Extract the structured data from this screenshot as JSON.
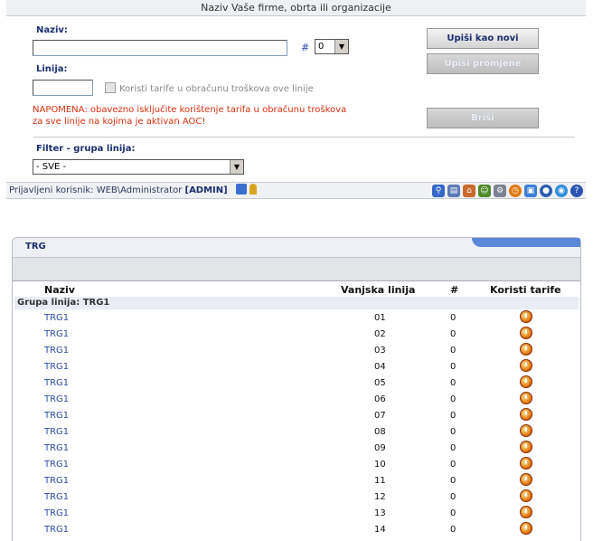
{
  "header": {
    "title": "Naziv Vaše firme, obrta ili organizacije"
  },
  "form": {
    "naziv_label": "Naziv:",
    "naziv_value": "",
    "hash_label": "#",
    "hash_select_value": "0",
    "linija_label": "Linija:",
    "linija_value": "",
    "tarife_checkbox_label": "Koristi tarife u obračunu troškova ove linije",
    "note": "NAPOMENA: obavezno isključite korištenje tarifa u obračunu troškova za sve linije na kojima je aktivan AOC!",
    "filter_label": "Filter - grupa linija:",
    "filter_value": "- SVE -"
  },
  "buttons": {
    "save_new": "Upiši kao novi",
    "save_changes": "Upiši promjene",
    "delete": "Briši"
  },
  "userbar": {
    "prefix": "Prijavljeni korisnik:",
    "user": "WEB\\Administrator",
    "role": "[ADMIN]"
  },
  "panel": {
    "title": "TRG",
    "columns": {
      "name": "Naziv",
      "line": "Vanjska linija",
      "hash": "#",
      "tariffs": "Koristi tarife"
    },
    "group_label": "Grupa linija: TRG1",
    "rows": [
      {
        "name": "TRG1",
        "line": "01",
        "hash": "0"
      },
      {
        "name": "TRG1",
        "line": "02",
        "hash": "0"
      },
      {
        "name": "TRG1",
        "line": "03",
        "hash": "0"
      },
      {
        "name": "TRG1",
        "line": "04",
        "hash": "0"
      },
      {
        "name": "TRG1",
        "line": "05",
        "hash": "0"
      },
      {
        "name": "TRG1",
        "line": "06",
        "hash": "0"
      },
      {
        "name": "TRG1",
        "line": "07",
        "hash": "0"
      },
      {
        "name": "TRG1",
        "line": "08",
        "hash": "0"
      },
      {
        "name": "TRG1",
        "line": "09",
        "hash": "0"
      },
      {
        "name": "TRG1",
        "line": "10",
        "hash": "0"
      },
      {
        "name": "TRG1",
        "line": "11",
        "hash": "0"
      },
      {
        "name": "TRG1",
        "line": "12",
        "hash": "0"
      },
      {
        "name": "TRG1",
        "line": "13",
        "hash": "0"
      },
      {
        "name": "TRG1",
        "line": "14",
        "hash": "0"
      }
    ]
  },
  "icons": [
    "search-icon",
    "book-icon",
    "home-icon",
    "users-icon",
    "gear-icon",
    "clock-icon",
    "window-icon",
    "disk-icon",
    "globe-icon",
    "help-icon"
  ]
}
